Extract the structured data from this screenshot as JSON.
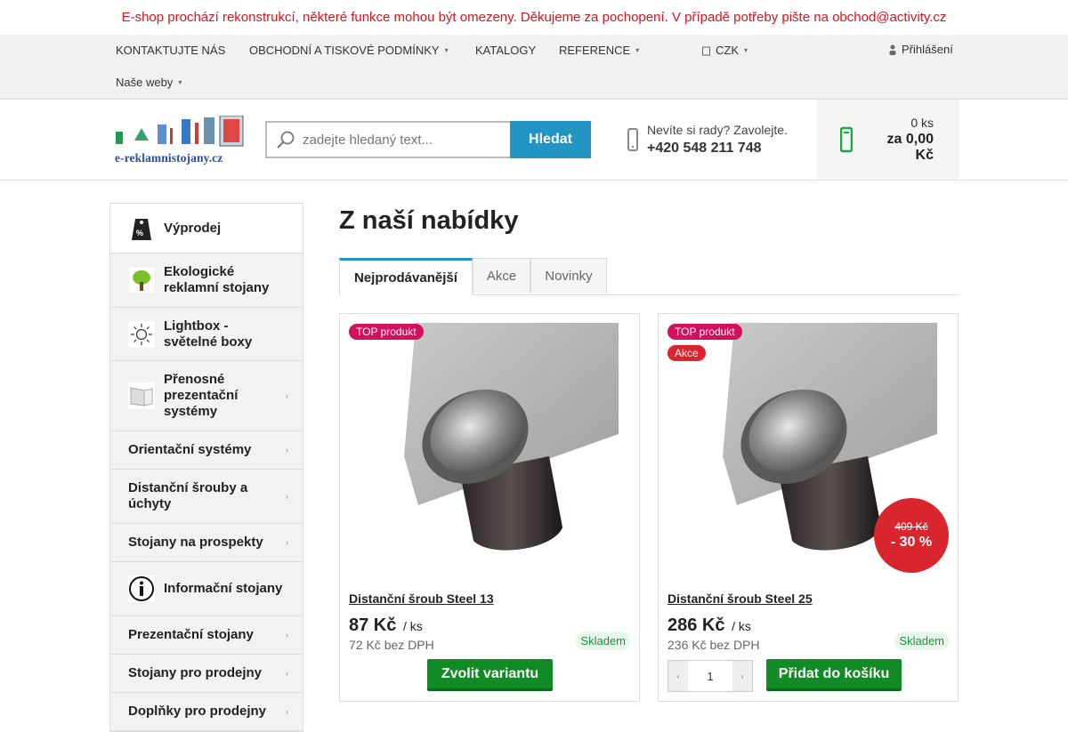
{
  "notice": "E-shop prochází rekonstrukcí, některé funkce mohou být omezeny. Děkujeme za pochopení. V případě potřeby pište na obchod@activity.cz",
  "topnav": {
    "contact": "KONTAKTUJTE NÁS",
    "terms": "OBCHODNÍ A TISKOVÉ PODMÍNKY",
    "catalogs": "KATALOGY",
    "references": "REFERENCE",
    "currency": "CZK",
    "login": "Přihlášení",
    "our_sites": "Naše weby",
    "caret": "▾"
  },
  "header": {
    "logo_text": "e-reklamnistojany.cz",
    "search_placeholder": "zadejte hledaný text...",
    "search_button": "Hledat",
    "help_line": "Nevíte si rady? Zavolejte.",
    "phone": "+420 548 211 748",
    "cart_count": "0 ks",
    "cart_total": "za 0,00 Kč"
  },
  "sidebar": {
    "categories": [
      {
        "label": "Výprodej",
        "icon": "sale-tag-icon"
      },
      {
        "label": "Ekologické reklamní stojany",
        "icon": "tree-icon"
      },
      {
        "label": "Lightbox - světelné boxy",
        "icon": "sun-icon"
      },
      {
        "label": "Přenosné prezentační systémy",
        "icon": "display-icon",
        "has_sub": true
      },
      {
        "label": "Orientační systémy",
        "has_sub": true
      },
      {
        "label": "Distanční šrouby a úchyty",
        "has_sub": true
      },
      {
        "label": "Stojany na prospekty",
        "has_sub": true
      },
      {
        "label": "Informační stojany",
        "icon": "info-icon"
      },
      {
        "label": "Prezentační stojany",
        "has_sub": true
      },
      {
        "label": "Stojany pro prodejny",
        "has_sub": true
      },
      {
        "label": "Doplňky pro prodejny",
        "has_sub": true
      }
    ]
  },
  "main": {
    "title": "Z naší nabídky",
    "tabs": [
      "Nejprodávanější",
      "Akce",
      "Novinky"
    ],
    "active_tab": "Nejprodávanější"
  },
  "products": [
    {
      "badges": [
        "TOP produkt"
      ],
      "name": "Distanční šroub Steel 13",
      "price": "87 Kč",
      "unit": "/ ks",
      "net_price": "72 Kč bez DPH",
      "stock": "Skladem",
      "button": "Zvolit variantu"
    },
    {
      "badges": [
        "TOP produkt",
        "Akce"
      ],
      "name": "Distanční šroub Steel 25",
      "price": "286 Kč",
      "unit": "/ ks",
      "net_price": "236 Kč bez DPH",
      "stock": "Skladem",
      "old_price": "409 Kč",
      "discount": "- 30 %",
      "quantity": "1",
      "button": "Přidat do košíku"
    }
  ],
  "colors": {
    "notice_red": "#d8161e",
    "accent_blue": "#2196c4",
    "cart_green": "#18a844",
    "button_green": "#128a25",
    "badge_pink": "#d1105e",
    "discount_red": "#d9252d"
  }
}
